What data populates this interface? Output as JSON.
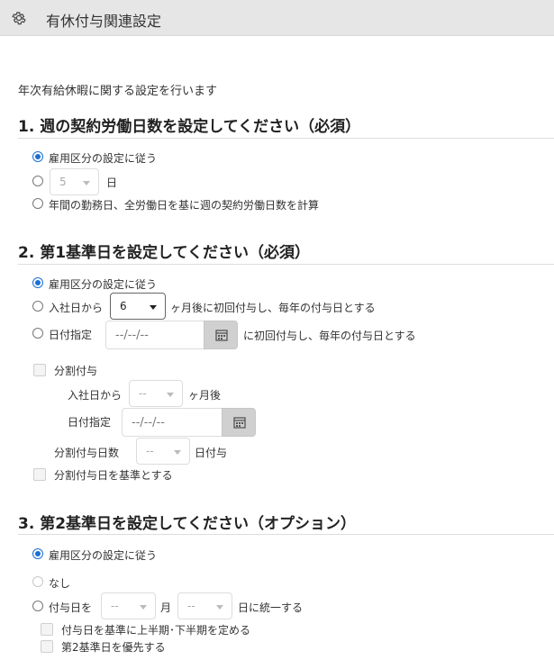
{
  "header": {
    "title": "有休付与関連設定",
    "icon": "gear-icon"
  },
  "intro": "年次有給休暇に関する設定を行います",
  "section1": {
    "title": "1. 週の契約労働日数を設定してください（必須）",
    "options": {
      "follow": "雇用区分の設定に従う",
      "days_value": "5",
      "days_unit": "日",
      "calc": "年間の勤務日、全労働日を基に週の契約労働日数を計算"
    },
    "selected": "follow"
  },
  "section2": {
    "title": "2. 第1基準日を設定してください（必須）",
    "follow": "雇用区分の設定に従う",
    "from_hire_prefix": "入社日から",
    "from_hire_value": "6",
    "from_hire_suffix": "ヶ月後に初回付与し、毎年の付与日とする",
    "date_label": "日付指定",
    "date_placeholder": "--/--/--",
    "date_suffix": "に初回付与し、毎年の付与日とする",
    "split": {
      "label": "分割付与",
      "hire_prefix": "入社日から",
      "hire_value": "--",
      "hire_suffix": "ヶ月後",
      "date_label": "日付指定",
      "date_placeholder": "--/--/--",
      "days_label": "分割付与日数",
      "days_value": "--",
      "days_suffix": "日付与",
      "base_label": "分割付与日を基準とする"
    },
    "selected": "follow"
  },
  "section3": {
    "title": "3. 第2基準日を設定してください（オプション）",
    "follow": "雇用区分の設定に従う",
    "none": "なし",
    "grant_prefix": "付与日を",
    "month_value": "--",
    "month_unit": "月",
    "day_value": "--",
    "day_suffix": "日に統一する",
    "half_label": "付与日を基準に上半期･下半期を定める",
    "priority_label": "第2基準日を優先する",
    "selected": "follow"
  },
  "colors": {
    "accent": "#1a6fd6",
    "header_bg": "#e6e6e6",
    "calendar_button": "#d0d0d0"
  }
}
